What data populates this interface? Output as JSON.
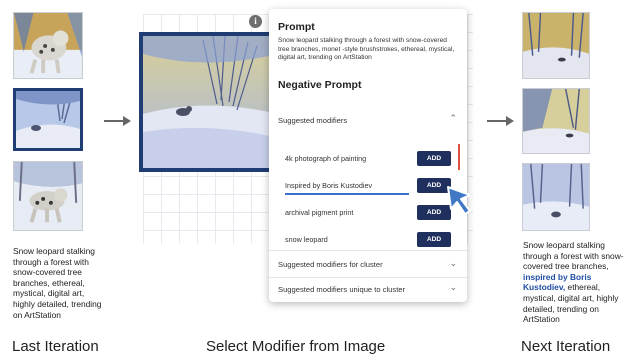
{
  "left_caption": "Snow leopard stalking through a forest with snow-covered tree branches, ethereal, mystical, digital art, highly detailed, trending on ArtStation",
  "titles": {
    "last": "Last Iteration",
    "select": "Select Modifier from Image",
    "next": "Next Iteration"
  },
  "panel": {
    "prompt_heading": "Prompt",
    "prompt_text": "Snow leopard stalking through a forest with snow-covered tree branches, monet -style brushstrokes, ethereal, mystical, digital art, trending on ArtStation",
    "negative_heading": "Negative Prompt",
    "suggested_heading": "Suggested modifiers",
    "modifiers": [
      {
        "label": "4k photograph of painting",
        "button": "ADD"
      },
      {
        "label": "Inspired by Boris Kustodiev",
        "button": "ADD"
      },
      {
        "label": "archival pigment print",
        "button": "ADD"
      },
      {
        "label": "snow leopard",
        "button": "ADD"
      }
    ],
    "cluster_heading": "Suggested modifiers for cluster",
    "unique_heading": "Suggested modifiers unique to cluster",
    "info_glyph": "i"
  },
  "right_caption": {
    "before": "Snow leopard stalking through a forest with snow-covered tree branches, ",
    "highlight": "inspired by Boris Kustodiev,",
    "after": " ethereal, mystical, digital art, highly detailed, trending on ArtStation"
  },
  "icons": {
    "arrow": "arrow-right-icon",
    "chevron_up": "chevron-up-icon",
    "chevron_down": "chevron-down-icon",
    "pointer": "pointer-cursor-icon"
  },
  "colors": {
    "add_button": "#1f2f5e",
    "selected_border": "#1f3d73",
    "highlight_text": "#1f4fa3",
    "underline": "#3a6fd0",
    "cursor": "#3f78c4"
  }
}
